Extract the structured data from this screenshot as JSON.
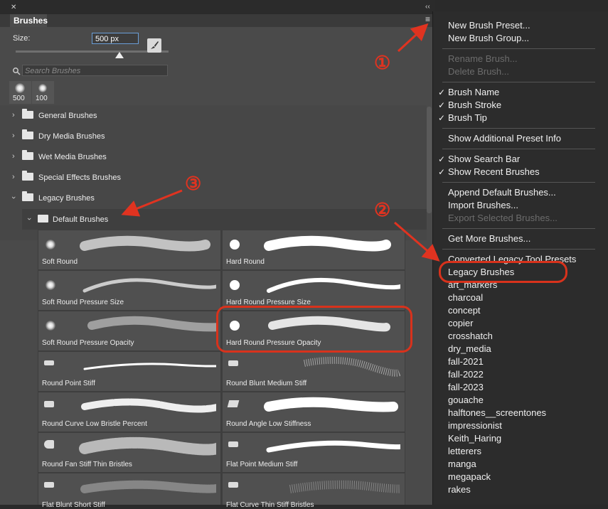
{
  "window": {
    "close_glyph": "✕",
    "collapse_glyph": "‹‹",
    "menu_glyph": "≡"
  },
  "panel": {
    "tab_label": "Brushes",
    "size_label": "Size:",
    "size_value": "500 px",
    "size_slider_level": 0.68,
    "search_placeholder": "Search Brushes",
    "recent_brushes": [
      "500",
      "100"
    ]
  },
  "groups": [
    {
      "label": "General Brushes",
      "expanded": false
    },
    {
      "label": "Dry Media Brushes",
      "expanded": false
    },
    {
      "label": "Wet Media Brushes",
      "expanded": false
    },
    {
      "label": "Special Effects Brushes",
      "expanded": false
    },
    {
      "label": "Legacy Brushes",
      "expanded": true
    }
  ],
  "subgroup": {
    "label": "Default Brushes",
    "expanded": true
  },
  "brush_tiles": [
    {
      "name": "Soft Round"
    },
    {
      "name": "Hard Round"
    },
    {
      "name": "Soft Round Pressure Size"
    },
    {
      "name": "Hard Round Pressure Size"
    },
    {
      "name": "Soft Round Pressure Opacity"
    },
    {
      "name": "Hard Round Pressure Opacity"
    },
    {
      "name": "Round Point Stiff"
    },
    {
      "name": "Round Blunt Medium Stiff"
    },
    {
      "name": "Round Curve Low Bristle Percent"
    },
    {
      "name": "Round Angle Low Stiffness"
    },
    {
      "name": "Round Fan Stiff Thin Bristles"
    },
    {
      "name": "Flat Point Medium Stiff"
    },
    {
      "name": "Flat Blunt Short Stiff"
    },
    {
      "name": "Flat Curve Thin Stiff Bristles"
    }
  ],
  "menu": {
    "sections": [
      {
        "items": [
          {
            "label": "New Brush Preset...",
            "enabled": true,
            "checked": false
          },
          {
            "label": "New Brush Group...",
            "enabled": true,
            "checked": false
          }
        ]
      },
      {
        "items": [
          {
            "label": "Rename Brush...",
            "enabled": false,
            "checked": false
          },
          {
            "label": "Delete Brush...",
            "enabled": false,
            "checked": false
          }
        ]
      },
      {
        "items": [
          {
            "label": "Brush Name",
            "enabled": true,
            "checked": true
          },
          {
            "label": "Brush Stroke",
            "enabled": true,
            "checked": true
          },
          {
            "label": "Brush Tip",
            "enabled": true,
            "checked": true
          }
        ]
      },
      {
        "items": [
          {
            "label": "Show Additional Preset Info",
            "enabled": true,
            "checked": false
          }
        ]
      },
      {
        "items": [
          {
            "label": "Show Search Bar",
            "enabled": true,
            "checked": true
          },
          {
            "label": "Show Recent Brushes",
            "enabled": true,
            "checked": true
          }
        ]
      },
      {
        "items": [
          {
            "label": "Append Default Brushes...",
            "enabled": true,
            "checked": false
          },
          {
            "label": "Import Brushes...",
            "enabled": true,
            "checked": false
          },
          {
            "label": "Export Selected Brushes...",
            "enabled": false,
            "checked": false
          }
        ]
      },
      {
        "items": [
          {
            "label": "Get More Brushes...",
            "enabled": true,
            "checked": false
          }
        ]
      },
      {
        "items": [
          {
            "label": "Converted Legacy Tool Presets",
            "enabled": true,
            "checked": false
          },
          {
            "label": "Legacy Brushes",
            "enabled": true,
            "checked": false
          },
          {
            "label": "art_markers",
            "enabled": true,
            "checked": false
          },
          {
            "label": "charcoal",
            "enabled": true,
            "checked": false
          },
          {
            "label": "concept",
            "enabled": true,
            "checked": false
          },
          {
            "label": "copier",
            "enabled": true,
            "checked": false
          },
          {
            "label": "crosshatch",
            "enabled": true,
            "checked": false
          },
          {
            "label": "dry_media",
            "enabled": true,
            "checked": false
          },
          {
            "label": "fall-2021",
            "enabled": true,
            "checked": false
          },
          {
            "label": "fall-2022",
            "enabled": true,
            "checked": false
          },
          {
            "label": "fall-2023",
            "enabled": true,
            "checked": false
          },
          {
            "label": "gouache",
            "enabled": true,
            "checked": false
          },
          {
            "label": "halftones__screentones",
            "enabled": true,
            "checked": false
          },
          {
            "label": "impressionist",
            "enabled": true,
            "checked": false
          },
          {
            "label": "Keith_Haring",
            "enabled": true,
            "checked": false
          },
          {
            "label": "letterers",
            "enabled": true,
            "checked": false
          },
          {
            "label": "manga",
            "enabled": true,
            "checked": false
          },
          {
            "label": "megapack",
            "enabled": true,
            "checked": false
          },
          {
            "label": "rakes",
            "enabled": true,
            "checked": false
          }
        ]
      }
    ]
  },
  "annotations": {
    "step1": "①",
    "step2": "②",
    "step3": "③",
    "color": "#e03320"
  },
  "colors": {
    "panel_bg": "#4a4a4a",
    "menu_bg": "#2c2c2c",
    "annotation_red": "#e03320"
  }
}
